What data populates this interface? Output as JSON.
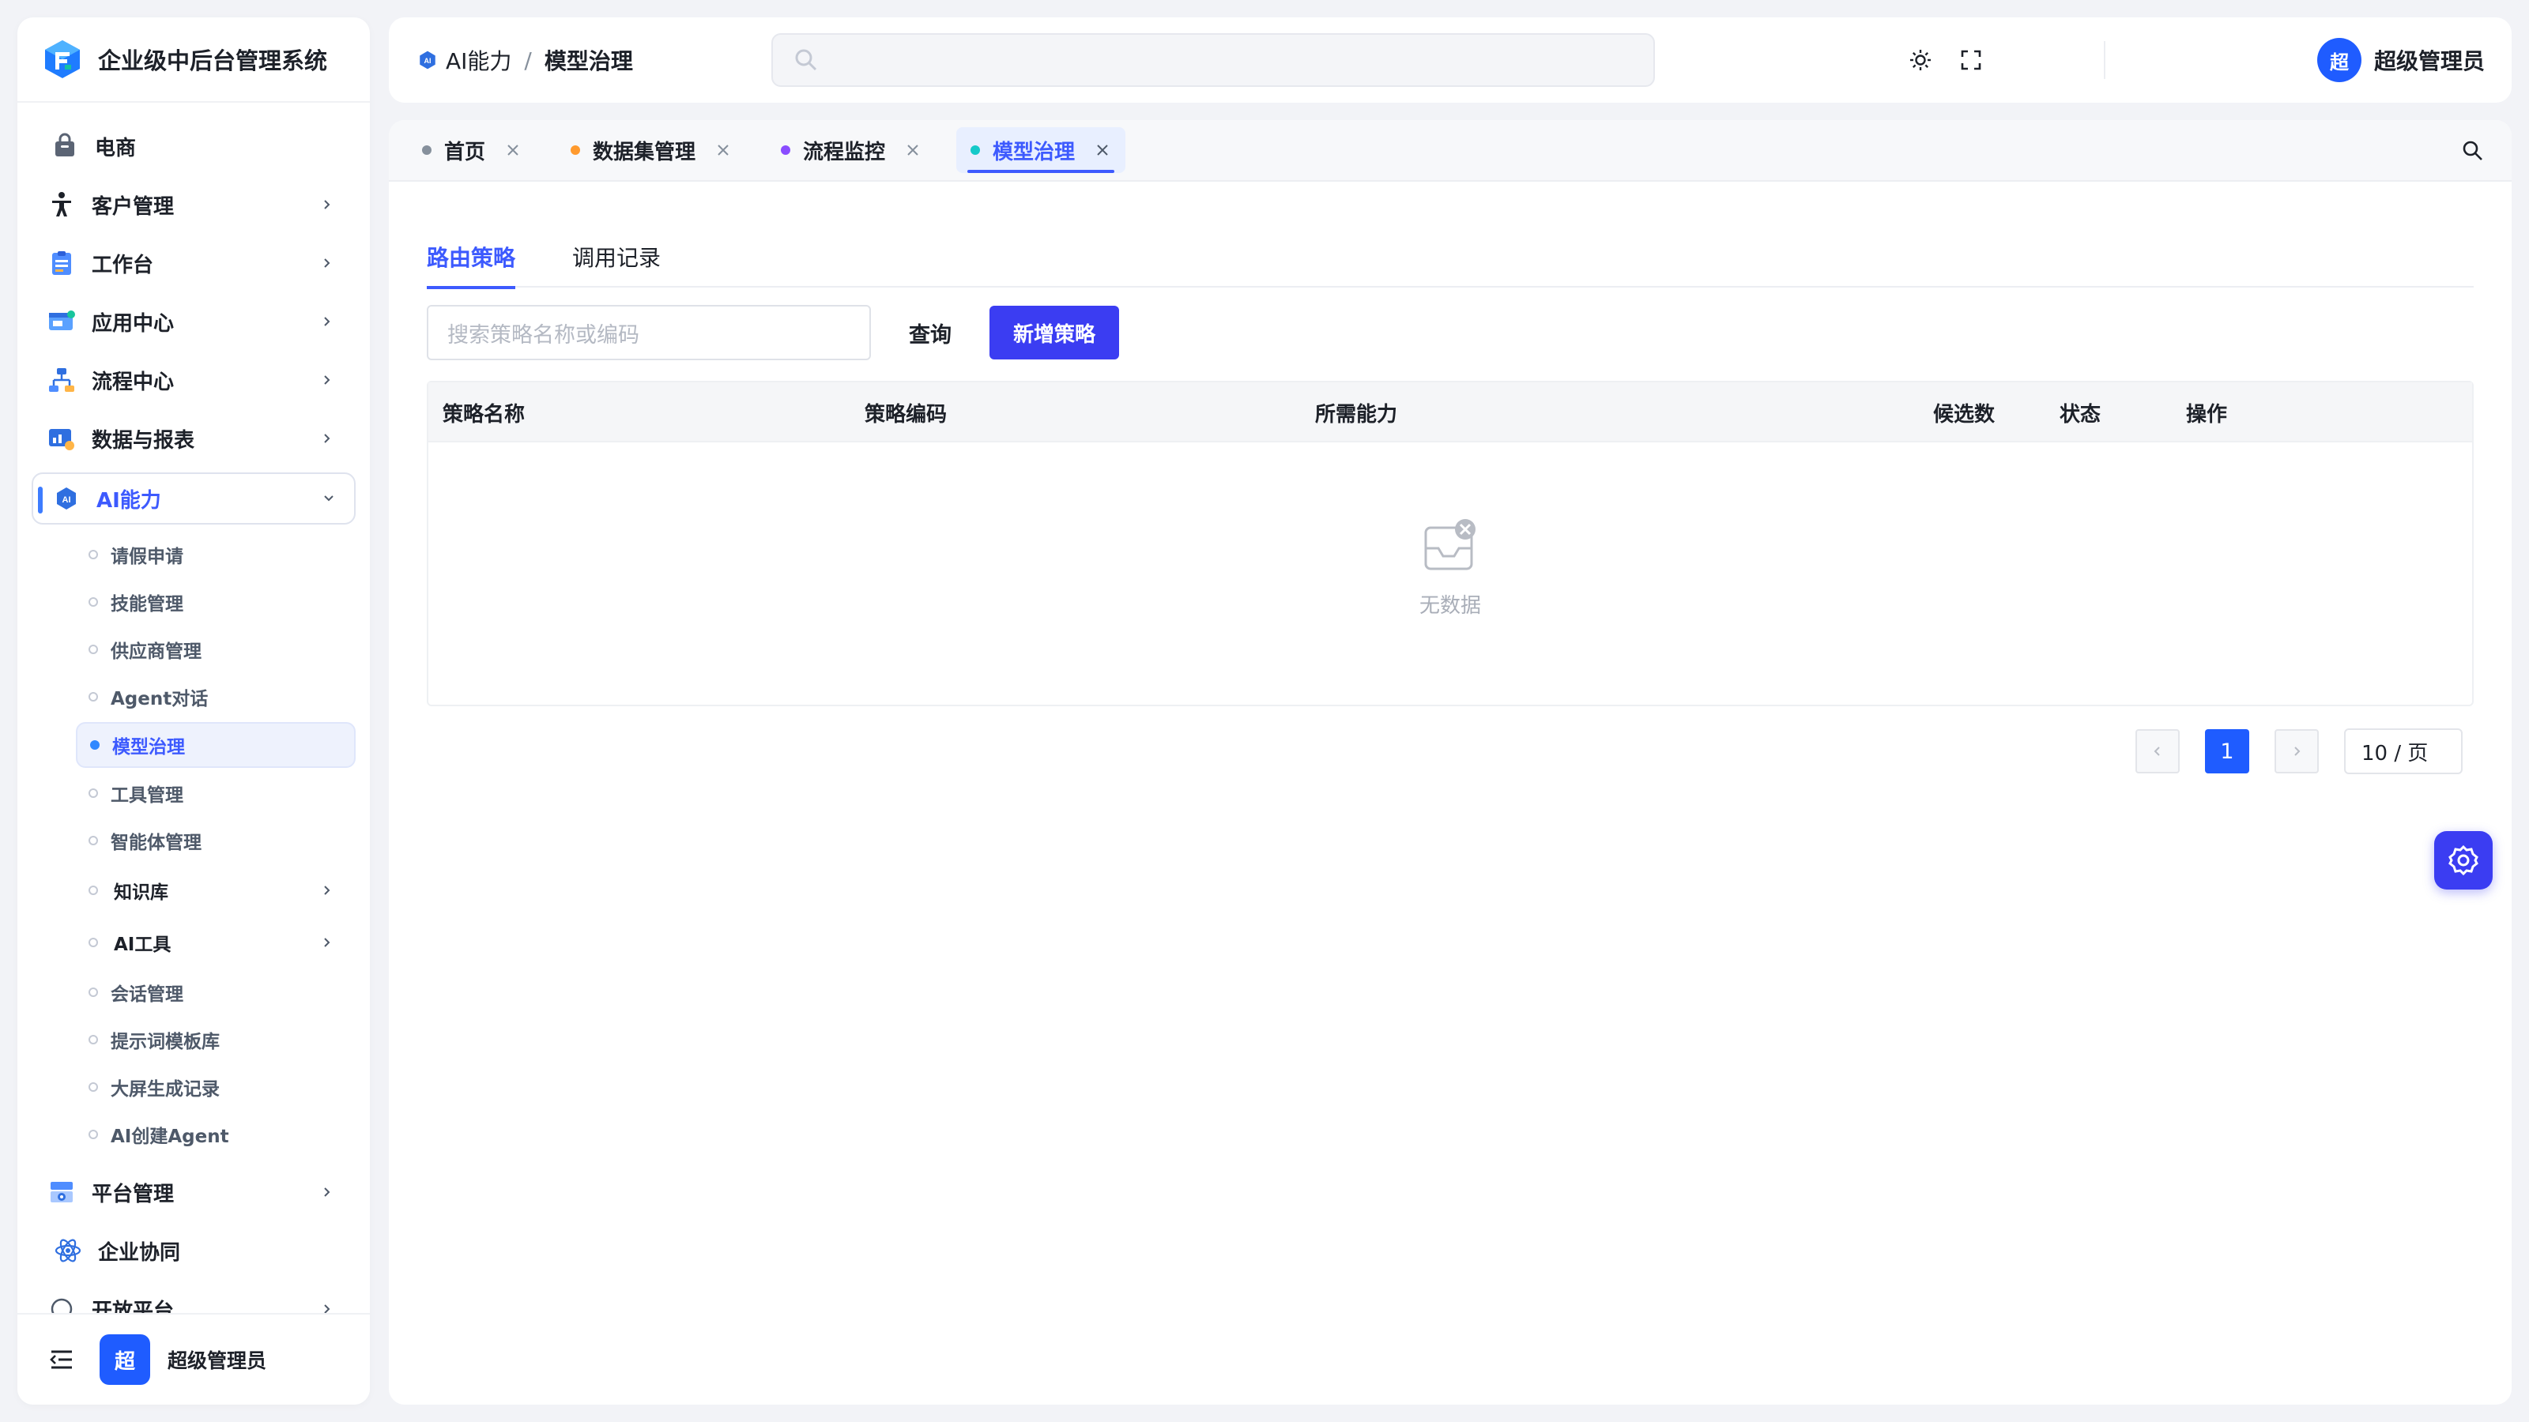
{
  "app": {
    "title": "企业级中后台管理系统"
  },
  "sidebar": {
    "items": [
      {
        "label": "电商"
      },
      {
        "label": "客户管理"
      },
      {
        "label": "工作台"
      },
      {
        "label": "应用中心"
      },
      {
        "label": "流程中心"
      },
      {
        "label": "数据与报表"
      },
      {
        "label": "AI能力"
      }
    ],
    "sub_items": [
      {
        "label": "请假申请"
      },
      {
        "label": "技能管理"
      },
      {
        "label": "供应商管理"
      },
      {
        "label": "Agent对话"
      },
      {
        "label": "模型治理"
      },
      {
        "label": "工具管理"
      },
      {
        "label": "智能体管理"
      },
      {
        "label": "知识库"
      },
      {
        "label": "AI工具"
      },
      {
        "label": "会话管理"
      },
      {
        "label": "提示词模板库"
      },
      {
        "label": "大屏生成记录"
      },
      {
        "label": "AI创建Agent"
      }
    ],
    "bottom_items": [
      {
        "label": "平台管理"
      },
      {
        "label": "企业协同"
      },
      {
        "label": "开放平台"
      }
    ],
    "footer": {
      "avatar": "超",
      "name": "超级管理员"
    }
  },
  "header": {
    "breadcrumb": {
      "parent": "AI能力",
      "separator": "/",
      "current": "模型治理"
    },
    "search_placeholder": "",
    "user": {
      "avatar": "超",
      "name": "超级管理员"
    }
  },
  "tabs": [
    {
      "label": "首页",
      "dot_color": "#86909c"
    },
    {
      "label": "数据集管理",
      "dot_color": "#ff9a2e"
    },
    {
      "label": "流程监控",
      "dot_color": "#8a4dff"
    },
    {
      "label": "模型治理",
      "dot_color": "#14c9c9"
    }
  ],
  "page": {
    "subtabs": [
      {
        "label": "路由策略"
      },
      {
        "label": "调用记录"
      }
    ],
    "search_placeholder": "搜索策略名称或编码",
    "query_label": "查询",
    "add_label": "新增策略",
    "table": {
      "columns": [
        {
          "label": "策略名称"
        },
        {
          "label": "策略编码"
        },
        {
          "label": "所需能力"
        },
        {
          "label": "候选数"
        },
        {
          "label": "状态"
        },
        {
          "label": "操作"
        }
      ],
      "empty_text": "无数据"
    },
    "pagination": {
      "current": "1",
      "page_size": "10 / 页"
    }
  },
  "colors": {
    "primary": "#3b3df2",
    "accent_blue": "#1f5cff",
    "active_text": "#3d5afe"
  }
}
